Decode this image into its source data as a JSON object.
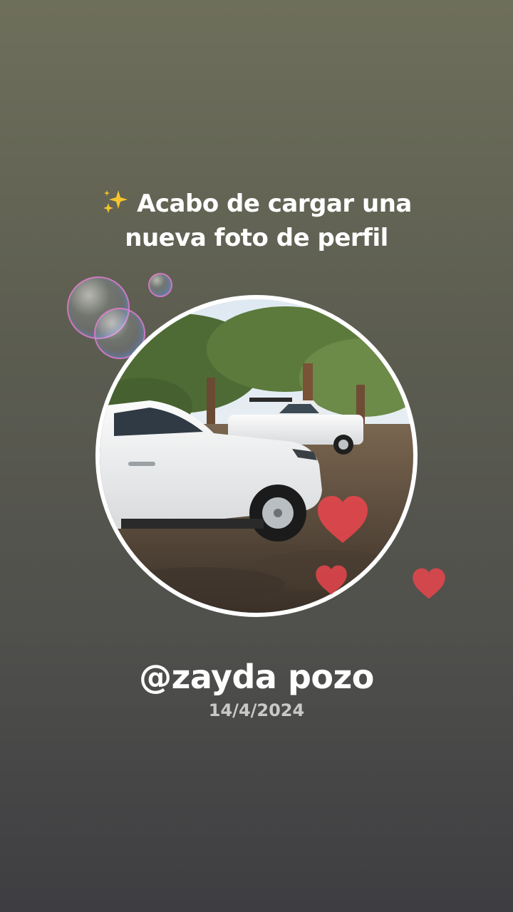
{
  "headline": {
    "line1": "Acabo de cargar una",
    "line2": "nueva foto de perfil",
    "emoji_icon": "sparkles-icon"
  },
  "profile": {
    "username": "@zayda pozo",
    "date": "14/4/2024"
  },
  "decorations": {
    "bubble_icon": "soap-bubble-icon",
    "heart_icon": "heart-icon",
    "heart_color": "#e8454c"
  },
  "colors": {
    "background_top": "#6e6f5b",
    "background_bottom": "#3e3e42",
    "text_primary": "#ffffff",
    "text_secondary": "#c9c9c9",
    "frame_border": "#ffffff"
  }
}
